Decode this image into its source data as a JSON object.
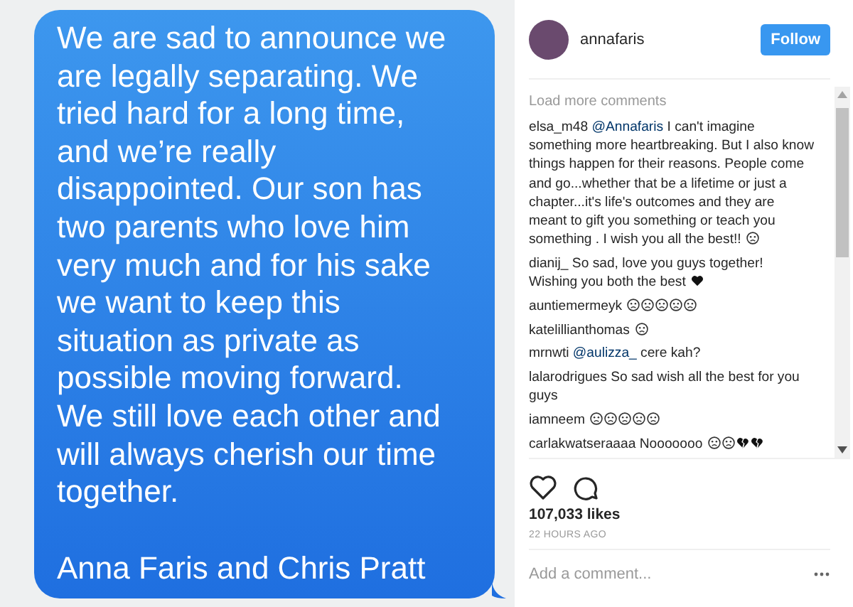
{
  "message": {
    "lines": [
      "We are sad to announce we",
      "are legally separating. We",
      "tried hard for a long time,",
      "and we’re really",
      "disappointed.  Our son has",
      "two parents who love him",
      "very much and for his sake",
      "we want to keep this",
      "situation as private as",
      "possible moving forward.",
      "We still love each other and",
      "will always cherish our time",
      "together."
    ],
    "signature": "Anna Faris and Chris Pratt"
  },
  "header": {
    "username": "annafaris",
    "follow_button": "Follow"
  },
  "load_more": "Load more comments",
  "comments": [
    {
      "user": "elsa_m48",
      "mention": "@Annafaris",
      "text": "I can't imagine something more heartbreaking. But I also know things happen for their reasons. People come and go...whether that be a lifetime or just a chapter...it's life's outcomes and they are meant to gift you something or teach you something . I wish you all the best!!",
      "emoji": [
        {
          "kind": "face"
        }
      ]
    },
    {
      "user": "dianij_",
      "text": "So sad, love you guys together! Wishing you both the best",
      "emoji": [
        {
          "kind": "heart"
        }
      ]
    },
    {
      "user": "auntiemermeyk",
      "emoji": [
        {
          "kind": "face"
        },
        {
          "kind": "face"
        },
        {
          "kind": "face"
        },
        {
          "kind": "face"
        },
        {
          "kind": "face"
        }
      ]
    },
    {
      "user": "katelillianthomas",
      "emoji": [
        {
          "kind": "face"
        }
      ]
    },
    {
      "user": "mrnwti",
      "mention": "@aulizza_",
      "text": "cere kah?"
    },
    {
      "user": "lalarodrigues",
      "text": "So sad wish all the best for you guys"
    },
    {
      "user": "iamneem",
      "emoji": [
        {
          "kind": "face"
        },
        {
          "kind": "face"
        },
        {
          "kind": "face"
        },
        {
          "kind": "face"
        },
        {
          "kind": "face"
        }
      ]
    },
    {
      "user": "carlakwatseraaaa",
      "text": "Nooooooo",
      "emoji": [
        {
          "kind": "face"
        },
        {
          "kind": "face"
        },
        {
          "kind": "broken-heart"
        },
        {
          "kind": "broken-heart"
        }
      ]
    }
  ],
  "likes": "107,033 likes",
  "time": "22 HOURS AGO",
  "comment_field": {
    "placeholder": "Add a comment..."
  }
}
